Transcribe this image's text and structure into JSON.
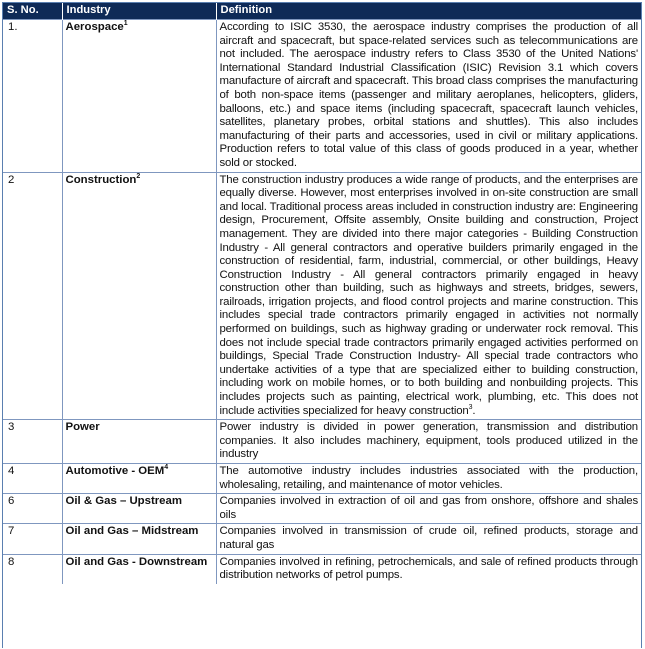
{
  "headers": {
    "sno": "S. No.",
    "industry": "Industry",
    "definition": "Definition"
  },
  "rows": [
    {
      "sno": "1.",
      "industry": "Aerospace",
      "sup": "1",
      "definition": "According to ISIC 3530, the aerospace industry comprises the production of all aircraft and spacecraft, but space-related services such as telecommunications are not included. The aerospace industry refers to Class 3530 of the United Nations' International Standard Industrial Classification (ISIC) Revision 3.1 which covers manufacture of aircraft and spacecraft. This broad class comprises the manufacturing of both non-space items (passenger and military aeroplanes, helicopters, gliders, balloons, etc.) and space items (including spacecraft, spacecraft launch vehicles, satellites, planetary probes, orbital stations and shuttles). This also includes manufacturing of their parts and accessories, used in civil or military applications. Production refers to total value of this class of goods produced in a year, whether sold or stocked.",
      "def_sup": ""
    },
    {
      "sno": "2",
      "industry": "Construction",
      "sup": "2",
      "definition": "The construction industry produces a wide range of products, and the enterprises are equally diverse. However, most enterprises involved in on-site construction are small and local. Traditional process areas included in construction industry are: Engineering design, Procurement, Offsite assembly, Onsite building and construction, Project management. They are divided into there major categories - Building Construction Industry - All general contractors and operative builders primarily engaged in the construction of residential, farm, industrial, commercial, or other buildings, Heavy Construction Industry - All general contractors primarily engaged in heavy construction other than building, such as highways and streets, bridges, sewers, railroads, irrigation projects, and flood control projects and marine construction. This includes special trade contractors primarily engaged in activities not normally performed on buildings, such as highway grading or underwater rock removal. This does not include special trade contractors primarily engaged activities performed on buildings, Special Trade Construction Industry- All special trade contractors who undertake activities of a type that are specialized either to building construction, including work on mobile homes, or to both building and nonbuilding projects. This includes projects such as painting, electrical work, plumbing, etc. This does not include activities specialized for heavy construction",
      "def_sup": "3"
    },
    {
      "sno": "3",
      "industry": "Power",
      "sup": "",
      "definition": "Power industry is divided in power generation, transmission and distribution companies. It also includes machinery, equipment, tools produced utilized in the industry",
      "def_sup": ""
    },
    {
      "sno": "4",
      "industry": "Automotive - OEM",
      "sup": "4",
      "definition": "The automotive industry includes industries associated with the production, wholesaling, retailing, and maintenance of motor vehicles.",
      "def_sup": ""
    },
    {
      "sno": "6",
      "industry": "Oil & Gas – Upstream",
      "sup": "",
      "definition": "Companies involved in extraction of oil and gas from onshore, offshore and shales oils",
      "def_sup": ""
    },
    {
      "sno": "7",
      "industry": "Oil and Gas – Midstream",
      "sup": "",
      "definition": "Companies involved in transmission of crude oil, refined products, storage and natural gas",
      "def_sup": ""
    },
    {
      "sno": "8",
      "industry": "Oil and Gas - Downstream",
      "sup": "",
      "definition": "Companies involved in refining, petrochemicals, and sale of refined products through distribution networks of petrol pumps.",
      "def_sup": ""
    }
  ]
}
